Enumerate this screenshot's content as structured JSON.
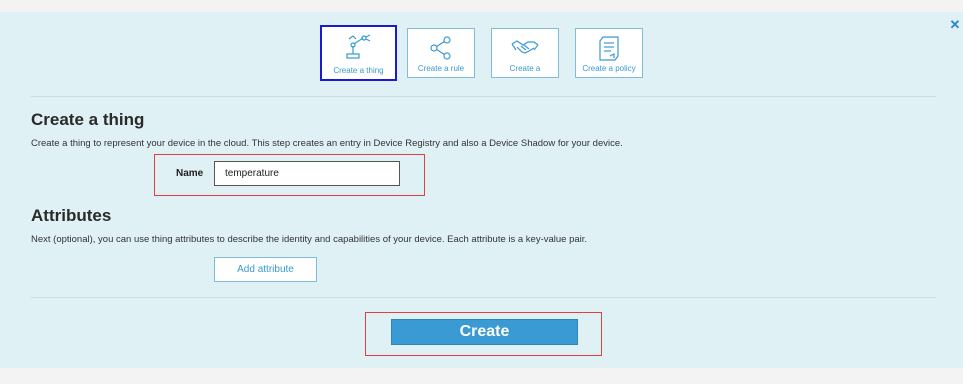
{
  "tiles": [
    {
      "label": "Create a thing",
      "icon": "robot-arm-icon",
      "selected": true
    },
    {
      "label": "Create a rule",
      "icon": "share-nodes-icon",
      "selected": false
    },
    {
      "label": "Create a",
      "icon": "handshake-icon",
      "selected": false
    },
    {
      "label": "Create a policy",
      "icon": "document-icon",
      "selected": false
    }
  ],
  "thing_section": {
    "title": "Create a thing",
    "description": "Create a thing to represent your device in the cloud. This step creates an entry in Device Registry and also a Device Shadow for your device.",
    "name_label": "Name",
    "name_value": "temperature"
  },
  "attributes_section": {
    "title": "Attributes",
    "description": "Next (optional), you can use thing attributes to describe the identity and capabilities of your device. Each attribute is a key-value pair.",
    "add_button": "Add attribute"
  },
  "create_button": "Create",
  "close_icon": "close-icon",
  "colors": {
    "accent": "#3a9ad4",
    "panel_bg": "#e0f1f6",
    "highlight_red": "#e0403f",
    "selected_border": "#1a1ad0"
  }
}
